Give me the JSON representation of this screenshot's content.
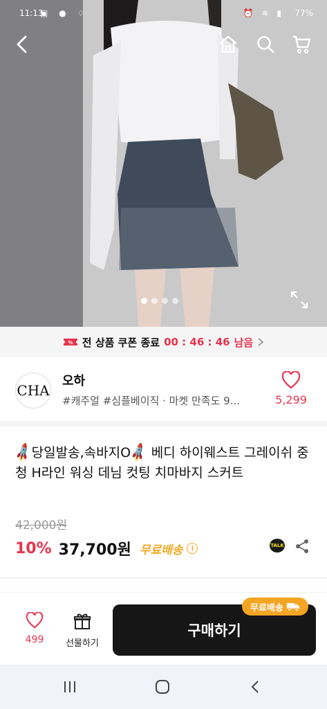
{
  "status_bar": {
    "time": "11:13",
    "battery": "77%"
  },
  "coupon": {
    "text": "전 상품 쿠폰 종료",
    "timer": "00 : 46 : 46",
    "suffix": "남음"
  },
  "seller": {
    "logo_text": "CHA",
    "name": "오하",
    "tags": "#캐주얼 #심플베이직 · 마켓 만족도 9...",
    "like_count": "5,299"
  },
  "product": {
    "title_segments": [
      "당일발송,속바지O",
      " 베디 하이웨스트 그레이쉬 중청 H라인 워싱 데님 컷팅 치마바지 스커트"
    ],
    "original_price": "42,000원",
    "discount": "10%",
    "price": "37,700원",
    "free_shipping": "무료배송",
    "info": "i",
    "talk": "TALK"
  },
  "gallery": {
    "page_index": 1,
    "page_count": 4
  },
  "bottom_bar": {
    "like_count": "499",
    "gift_label": "선물하기",
    "buy_label": "구매하기",
    "ship_badge": "무료배송"
  },
  "colors": {
    "accent_red": "#e8344e",
    "ship_orange": "#f5a524",
    "buy_bg": "#161616"
  },
  "icons": [
    "back-icon",
    "home-icon",
    "search-icon",
    "cart-icon",
    "expand-icon",
    "ticket-icon",
    "heart-icon",
    "info-icon",
    "talk-icon",
    "share-icon",
    "gift-icon",
    "truck-icon",
    "recents-icon",
    "home-nav-icon",
    "back-nav-icon"
  ]
}
